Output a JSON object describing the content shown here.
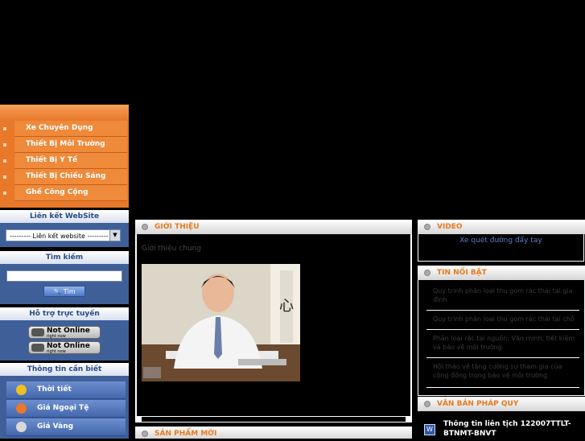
{
  "left_menu": {
    "items": [
      {
        "label": "Xe Chuyên Dụng"
      },
      {
        "label": "Thiết Bị Môi Trường"
      },
      {
        "label": "Thiết Bị Y Tế"
      },
      {
        "label": "Thiết Bị Chiếu Sáng"
      },
      {
        "label": "Ghế Công Cộng"
      }
    ]
  },
  "links": {
    "title": "Liên kết WebSite",
    "select_value": "--------- Liên kết website ---------"
  },
  "search": {
    "title": "Tìm kiếm",
    "button": "Tìm",
    "value": ""
  },
  "support": {
    "title": "Hỗ trợ trực tuyến",
    "status_line1": "Not Online",
    "status_line2": "right now"
  },
  "info": {
    "title": "Thông tin cần biết",
    "items": [
      {
        "label": "Thời tiết",
        "color": "#f0c020"
      },
      {
        "label": "Giá Ngoại Tệ",
        "color": "#e8782a"
      },
      {
        "label": "Giá Vàng",
        "color": "#d9d9d9"
      }
    ]
  },
  "intro": {
    "title": "GIỚI THIỆU",
    "subtitle": "Giới thiệu chung"
  },
  "new_products": {
    "title": "SẢN PHẨM MỚI"
  },
  "video": {
    "title": "VIDEO",
    "link": "Xe quét đường đẩy tay"
  },
  "featured": {
    "title": "TIN NỔI BẬT",
    "items": [
      "Quy trình phân loại thu gom rác thải tại gia đình",
      "Quy trình phân loại thu gom rác thải tại chỗ",
      "Phân loại rác tại nguồn: Văn minh, tiết kiệm và bảo vệ môi trường",
      "Hội thảo về tăng cường sự tham gia của cộng đồng trong bảo vệ môi trường"
    ]
  },
  "legal": {
    "title": "VĂN BẢN PHÁP QUY",
    "doc": "Thông tin liên tịch 122007TTLT-BTNMT-BNVT"
  },
  "colors": {
    "accent": "#e8782a",
    "panel": "#3f5f99"
  }
}
